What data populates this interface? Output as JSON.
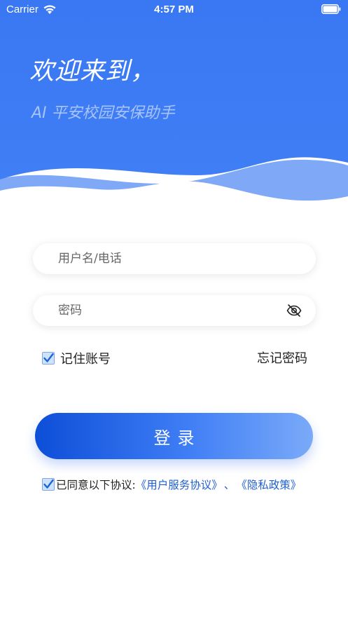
{
  "status_bar": {
    "carrier": "Carrier",
    "time": "4:57 PM"
  },
  "header": {
    "title": "欢迎来到，",
    "subtitle": "AI 平安校园安保助手"
  },
  "login_form": {
    "username_placeholder": "用户名/电话",
    "password_placeholder": "密码",
    "remember_label": "记住账号",
    "remember_checked": true,
    "forgot_label": "忘记密码",
    "login_label": "登录"
  },
  "agreement": {
    "checked": true,
    "prefix": "已同意以下协议:",
    "user_agreement": "《用户服务协议》",
    "separator": "、",
    "privacy_policy": "《隐私政策》"
  },
  "colors": {
    "brand_blue": "#3a78f2",
    "wave_light": "#7ea8f7",
    "link_blue": "#1f5fd1"
  }
}
